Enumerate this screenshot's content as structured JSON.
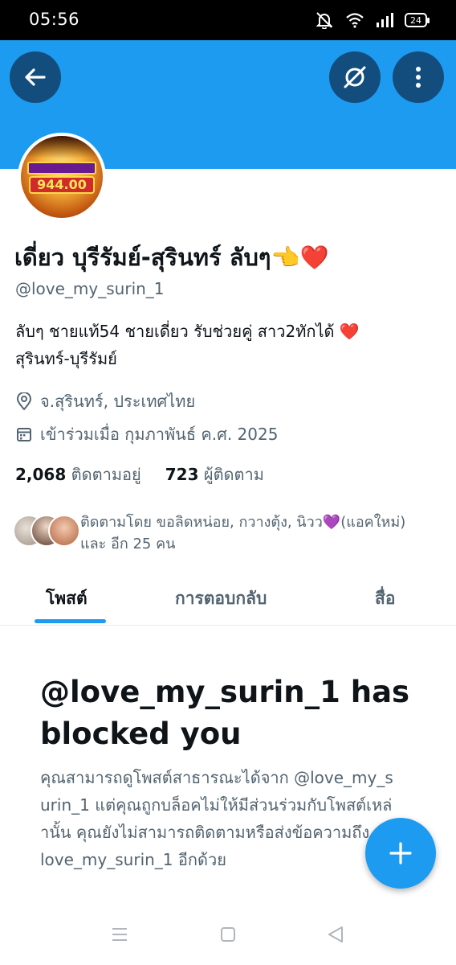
{
  "status_bar": {
    "time": "05:56",
    "battery": "24"
  },
  "header": {
    "back_icon": "arrow-left-icon",
    "grok_icon": "grok-icon",
    "more_icon": "more-vertical-icon",
    "banner_color": "#1d9bf0"
  },
  "profile": {
    "avatar_text": "944.00",
    "display_name": "เดี่ยว บุรีรัมย์-สุรินทร์ ลับๆ👈❤️",
    "handle": "@love_my_surin_1",
    "bio_line1": "ลับๆ ชายแท้54 ชายเดี่ยว รับช่วยคู่ สาว2ทักได้ ❤️",
    "bio_line2": "สุรินทร์-บุรีรัมย์",
    "location": "จ.สุรินทร์, ประเทศไทย",
    "joined": "เข้าร่วมเมื่อ กุมภาพันธ์ ค.ศ. 2025",
    "following_count": "2,068",
    "following_label": "ติดตามอยู่",
    "followers_count": "723",
    "followers_label": "ผู้ติดตาม",
    "followed_by_line1": "ติดตามโดย ขอลิดหน่อย, กวางตุ้ง, นิวว💜(แอคใหม่)",
    "followed_by_line2": "และ อีก 25 คน"
  },
  "tabs": [
    {
      "label": "โพสต์",
      "active": true
    },
    {
      "label": "การตอบกลับ",
      "active": false
    },
    {
      "label": "สื่อ",
      "active": false
    }
  ],
  "blocked": {
    "title": "@love_my_surin_1 has blocked you",
    "body": "คุณสามารถดูโพสต์สาธารณะได้จาก @love_my_surin_1 แต่คุณถูกบล็อคไม่ให้มีส่วนร่วมกับโพสต์เหล่านั้น คุณยังไม่สามารถติดตามหรือส่งข้อความถึง @love_my_surin_1 อีกด้วย"
  },
  "fab": {
    "icon": "plus-icon",
    "color": "#1d9bf0"
  },
  "nav": {
    "icons": [
      "recent-apps-icon",
      "home-icon",
      "back-icon"
    ]
  }
}
